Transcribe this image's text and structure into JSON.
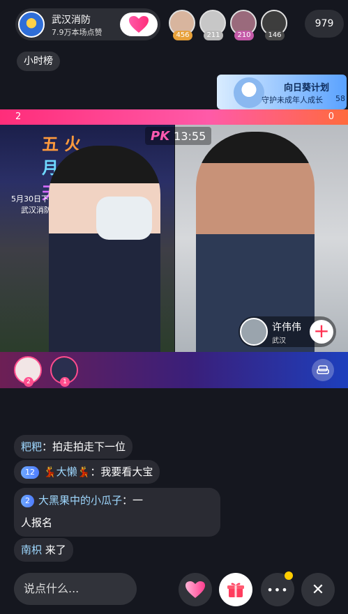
{
  "header": {
    "anchor_name": "武汉消防",
    "anchor_likes": "7.9万本场点赞",
    "viewers": [
      {
        "count": "456",
        "color": "#e7a13a"
      },
      {
        "count": "211",
        "color": "#ffffff"
      },
      {
        "count": "210",
        "color": "#c45aa8"
      },
      {
        "count": "146",
        "color": "#4a4a4a"
      }
    ],
    "online_count": "979",
    "rank_label": "小时榜"
  },
  "banner": {
    "title": "向日葵计划",
    "subtitle": "守护未成年人成长",
    "num": "58"
  },
  "pk": {
    "score_left": "2",
    "score_right": "0",
    "logo": "PK",
    "timer": "13:55"
  },
  "video_left": {
    "line1": "五 火",
    "line2": "月 焰",
    "line3": "天 蓝",
    "caption": "5月30日下午2",
    "caption2": "武汉消防科"
  },
  "guest": {
    "name": "许伟伟",
    "location": "武汉",
    "add_symbol": "+"
  },
  "contributors": [
    "2",
    "1"
  ],
  "chat": [
    {
      "badge": "",
      "name": "粑粑",
      "text": "：拍走拍走下一位"
    },
    {
      "badge": "12",
      "name": "💃大懒💃",
      "text": "：我要看大宝"
    },
    {
      "badge": "2",
      "name": "大黑果中的小瓜子",
      "text": "：一",
      "text2": "人报名"
    },
    {
      "badge": "",
      "name": "南枳",
      "text": " 来了"
    }
  ],
  "bottom": {
    "input_placeholder": "说点什么...",
    "more_symbol": "•••",
    "close_symbol": "✕"
  }
}
